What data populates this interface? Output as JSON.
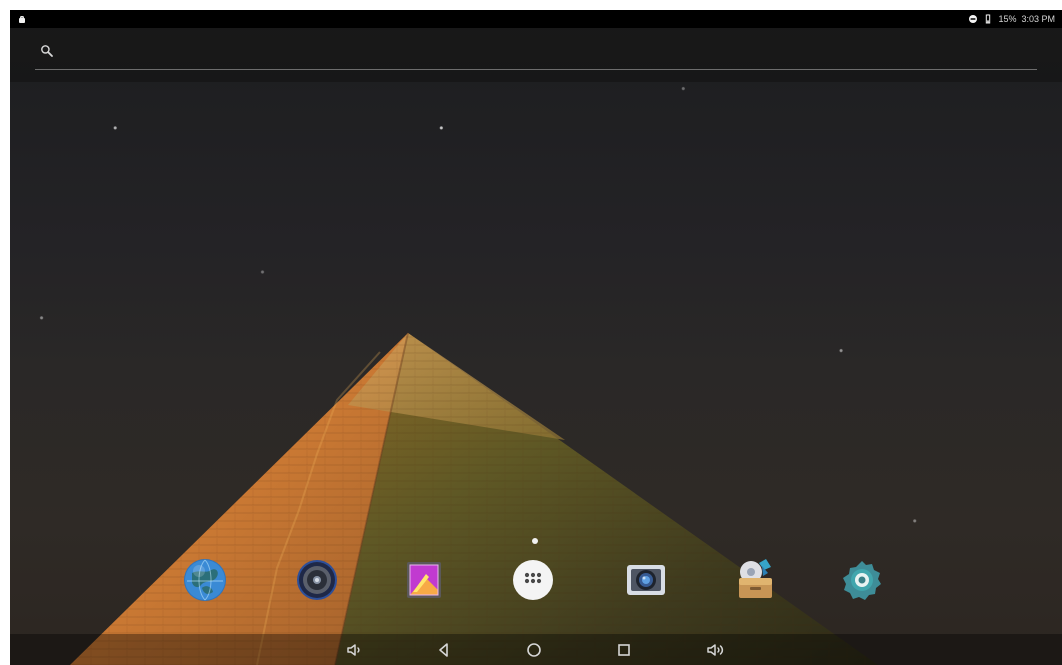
{
  "status_bar": {
    "battery": "15%",
    "time": "3:03 PM",
    "notification_icon": "android-robot-icon",
    "dnd_icon": "do-not-disturb-icon",
    "battery_icon": "battery-icon"
  },
  "search": {
    "placeholder": "",
    "icon": "search-icon"
  },
  "wallpaper": {
    "scene": "night-sky-pyramid"
  },
  "page_indicator": {
    "active_page": 1,
    "total_pages": 1
  },
  "dock": {
    "apps": [
      {
        "icon": "browser-globe-icon",
        "color": "#2f74bd"
      },
      {
        "icon": "music-speaker-icon",
        "color": "#3b63b0"
      },
      {
        "icon": "gallery-photo-icon",
        "color": "#c33cc5"
      },
      {
        "icon": "app-drawer-icon",
        "color": "#f4f4f4"
      },
      {
        "icon": "camera-icon",
        "color": "#3b3f4a"
      },
      {
        "icon": "file-manager-icon",
        "color": "#d2a25f"
      },
      {
        "icon": "settings-gear-icon",
        "color": "#44a0a8"
      }
    ]
  },
  "navigation": {
    "volume_down_icon": "volume-down-icon",
    "back_icon": "back-icon",
    "home_icon": "home-icon",
    "recents_icon": "recents-icon",
    "volume_up_icon": "volume-up-icon"
  }
}
